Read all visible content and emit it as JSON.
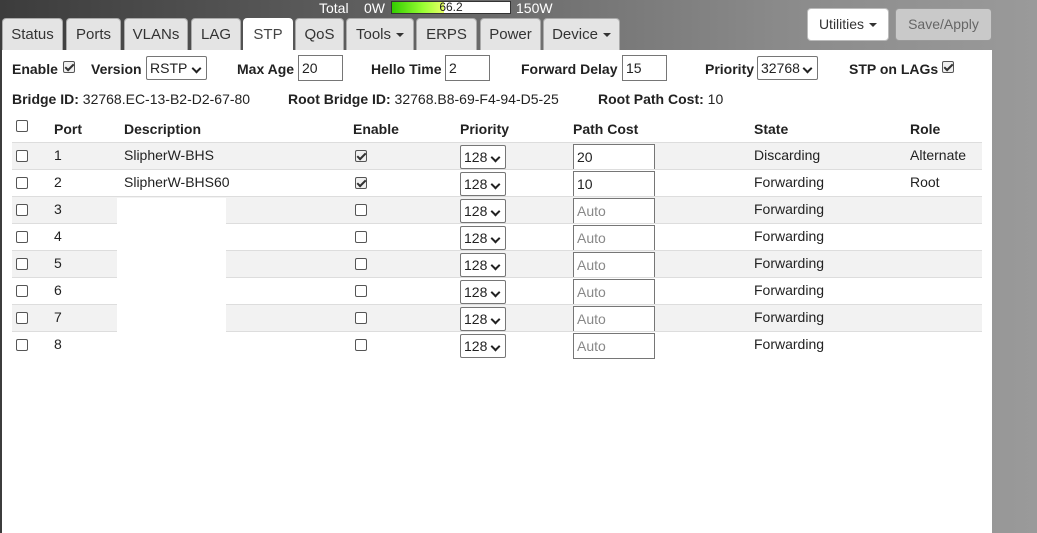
{
  "power": {
    "total_label": "Total",
    "min_label": "0W",
    "value": "66.2",
    "max_label": "150W",
    "fill_percent": 44
  },
  "tabs": [
    {
      "label": "Status"
    },
    {
      "label": "Ports"
    },
    {
      "label": "VLANs"
    },
    {
      "label": "LAG"
    },
    {
      "label": "STP",
      "active": true
    },
    {
      "label": "QoS"
    },
    {
      "label": "Tools",
      "dropdown": true
    },
    {
      "label": "ERPS"
    },
    {
      "label": "Power"
    },
    {
      "label": "Device",
      "dropdown": true
    }
  ],
  "toolbar": {
    "utilities_label": "Utilities",
    "save_label": "Save/Apply"
  },
  "settings": {
    "enable_label": "Enable",
    "enable_checked": true,
    "version_label": "Version",
    "version_value": "RSTP",
    "max_age_label": "Max Age",
    "max_age_value": "20",
    "hello_time_label": "Hello Time",
    "hello_time_value": "2",
    "forward_delay_label": "Forward Delay",
    "forward_delay_value": "15",
    "priority_label": "Priority",
    "priority_value": "32768",
    "stp_lags_label": "STP on LAGs",
    "stp_lags_checked": true
  },
  "info": {
    "bridge_id_label": "Bridge ID:",
    "bridge_id_value": "32768.EC-13-B2-D2-67-80",
    "root_bridge_label": "Root Bridge ID:",
    "root_bridge_value": "32768.B8-69-F4-94-D5-25",
    "root_path_label": "Root Path Cost:",
    "root_path_value": "10"
  },
  "table": {
    "headers": {
      "port": "Port",
      "description": "Description",
      "enable": "Enable",
      "priority": "Priority",
      "path_cost": "Path Cost",
      "state": "State",
      "role": "Role"
    },
    "rows": [
      {
        "port": "1",
        "description": "SlipherW-BHS",
        "enabled": true,
        "priority": "128",
        "path_cost": "20",
        "placeholder": "",
        "state": "Discarding",
        "role": "Alternate"
      },
      {
        "port": "2",
        "description": "SlipherW-BHS60",
        "enabled": true,
        "priority": "128",
        "path_cost": "10",
        "placeholder": "",
        "state": "Forwarding",
        "role": "Root"
      },
      {
        "port": "3",
        "description": "",
        "enabled": false,
        "priority": "128",
        "path_cost": "",
        "placeholder": "Auto",
        "state": "Forwarding",
        "role": ""
      },
      {
        "port": "4",
        "description": "",
        "enabled": false,
        "priority": "128",
        "path_cost": "",
        "placeholder": "Auto",
        "state": "Forwarding",
        "role": ""
      },
      {
        "port": "5",
        "description": "",
        "enabled": false,
        "priority": "128",
        "path_cost": "",
        "placeholder": "Auto",
        "state": "Forwarding",
        "role": ""
      },
      {
        "port": "6",
        "description": "",
        "enabled": false,
        "priority": "128",
        "path_cost": "",
        "placeholder": "Auto",
        "state": "Forwarding",
        "role": ""
      },
      {
        "port": "7",
        "description": "",
        "enabled": false,
        "priority": "128",
        "path_cost": "",
        "placeholder": "Auto",
        "state": "Forwarding",
        "role": ""
      },
      {
        "port": "8",
        "description": "",
        "enabled": false,
        "priority": "128",
        "path_cost": "",
        "placeholder": "Auto",
        "state": "Forwarding",
        "role": ""
      }
    ]
  }
}
